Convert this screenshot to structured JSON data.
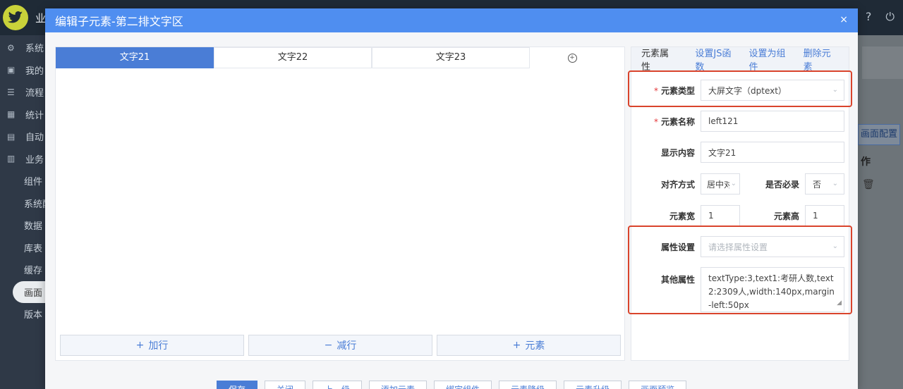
{
  "app": {
    "title": "业",
    "top_icons": [
      "question-icon",
      "power-icon"
    ]
  },
  "sidebar": {
    "items": [
      {
        "label": "系统",
        "icon": "gear-icon"
      },
      {
        "label": "我的",
        "icon": "user-icon"
      },
      {
        "label": "流程",
        "icon": "flow-icon"
      },
      {
        "label": "统计",
        "icon": "chart-icon"
      },
      {
        "label": "自动",
        "icon": "auto-icon"
      },
      {
        "label": "业务",
        "icon": "biz-icon"
      }
    ],
    "subitems": [
      "组件",
      "系统配",
      "数据",
      "库表",
      "缓存",
      "画面",
      "版本"
    ],
    "active_sub": "画面"
  },
  "background": {
    "config_button": "画面配置",
    "op_col": "作"
  },
  "modal": {
    "title": "编辑子元素-第二排文字区",
    "close": "×",
    "tabs": [
      "文字21",
      "文字22",
      "文字23"
    ],
    "tab_add": "+",
    "bottom_buttons": [
      {
        "icon": "+",
        "label": "加行"
      },
      {
        "icon": "−",
        "label": "减行"
      },
      {
        "icon": "+",
        "label": "元素"
      }
    ]
  },
  "props": {
    "title": "元素属性",
    "links": [
      "设置JS函数",
      "设置为组件",
      "删除元素"
    ],
    "fields": {
      "type": {
        "label": "元素类型",
        "value": "大屏文字（dptext）"
      },
      "name": {
        "label": "元素名称",
        "value": "left121"
      },
      "content": {
        "label": "显示内容",
        "value": "文字21"
      },
      "align": {
        "label": "对齐方式",
        "value": "居中对"
      },
      "required": {
        "label": "是否必录",
        "value": "否"
      },
      "width": {
        "label": "元素宽",
        "value": "1"
      },
      "height": {
        "label": "元素高",
        "value": "1"
      },
      "attr": {
        "label": "属性设置",
        "placeholder": "请选择属性设置"
      },
      "other": {
        "label": "其他属性",
        "value": "textType:3,text1:考研人数,text2:2309人,width:140px,margin-left:50px"
      }
    }
  },
  "footer": {
    "buttons": [
      "保存",
      "关闭",
      "上一级",
      "添加元素",
      "绑定组件",
      "元素降级",
      "元素升级",
      "画面预览"
    ]
  },
  "colors": {
    "accent": "#4a7dd6",
    "header": "#4f8ef0",
    "highlight": "#d9442c"
  }
}
